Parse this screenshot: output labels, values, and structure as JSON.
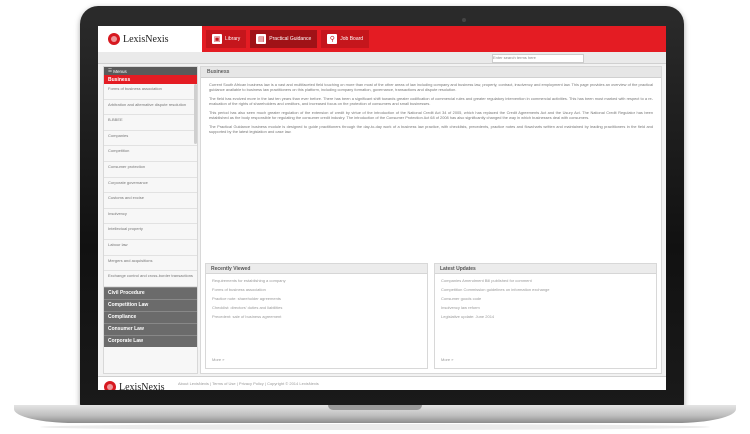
{
  "brand": {
    "name": "LexisNexis"
  },
  "nav": {
    "tabs": [
      {
        "label": "Library",
        "icon": "book-icon"
      },
      {
        "label": "Practical Guidance",
        "icon": "document-icon"
      },
      {
        "label": "Job Board",
        "icon": "search-icon"
      }
    ]
  },
  "search": {
    "placeholder": "Enter search terms here"
  },
  "sidebar": {
    "menu_label": "Menus",
    "active_section": "Business",
    "items": [
      "Forms of business association",
      "Arbitration and alternative dispute resolution",
      "B-BBEE",
      "Companies",
      "Competition",
      "Consumer protection",
      "Corporate governance",
      "Customs and excise",
      "Insolvency",
      "Intellectual property",
      "Labour law",
      "Mergers and acquisitions",
      "Exchange control and cross-border transactions"
    ],
    "sections": [
      "Civil Procedure",
      "Competition Law",
      "Compliance",
      "Consumer Law",
      "Corporate Law"
    ]
  },
  "main": {
    "title": "Business",
    "paragraphs": [
      "Current South African business law is a vast and multifaceted field touching on more than most of the other areas of law including company and business law, property, contract, insolvency and employment law. This page provides an overview of the practical guidance available to business law practitioners on this platform, including company formation, governance, transactions and dispute resolution.",
      "The field has evolved more in the last ten years than ever before. There has been a significant shift towards greater codification of commercial rules and greater regulatory intervention in commercial activities. This has been most marked with respect to a re-evaluation of the rights of shareholders and creditors, and increased focus on the protection of consumers and small businesses.",
      "This period has also seen much greater regulation of the extension of credit by virtue of the introduction of the National Credit Act 34 of 2005, which has replaced the Credit Agreements Act and the Usury Act. The National Credit Regulator has been established as the body responsible for regulating the consumer credit industry. The introduction of the Consumer Protection Act 68 of 2008 has also significantly changed the way in which businesses deal with consumers.",
      "The Practical Guidance business module is designed to guide practitioners through the day-to-day work of a business law practice, with checklists, precedents, practice notes and flowcharts written and maintained by leading practitioners in the field and supported by the latest legislation and case law."
    ]
  },
  "recently_viewed": {
    "title": "Recently Viewed",
    "items": [
      "Requirements for establishing a company",
      "Forms of business association",
      "Practice note: shareholder agreements",
      "Checklist: directors' duties and liabilities",
      "Precedent: sale of business agreement"
    ],
    "more": "More »"
  },
  "latest_updates": {
    "title": "Latest Updates",
    "items": [
      "Companies Amendment Bill published for comment",
      "Competition Commission guidelines on information exchange",
      "Consumer goods code",
      "Insolvency law reform",
      "Legislative update: June 2014"
    ],
    "more": "More »"
  },
  "footer": {
    "text": "About LexisNexis  |  Terms of Use  |  Privacy Policy  |  Copyright © 2014 LexisNexis"
  },
  "colors": {
    "brand_red": "#e41c23",
    "section_grey": "#6b6b6b",
    "bezel": "#111111"
  }
}
